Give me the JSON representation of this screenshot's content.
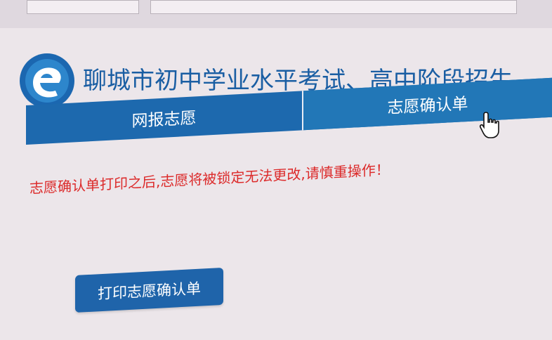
{
  "header": {
    "title": "聊城市初中学业水平考试、高中阶段招生"
  },
  "nav": {
    "tabs": [
      {
        "label": "网报志愿",
        "active": false
      },
      {
        "label": "志愿确认单",
        "active": true
      }
    ]
  },
  "notice": {
    "warning": "志愿确认单打印之后,志愿将被锁定无法更改,请慎重操作！"
  },
  "actions": {
    "print_label": "打印志愿确认单"
  },
  "colors": {
    "brand": "#1d69ae",
    "title": "#1a5ea3",
    "warning": "#dc2a2a",
    "button": "#1f64aa",
    "background": "#ece6ea"
  },
  "icons": {
    "logo": "site-logo-icon",
    "cursor": "hand-pointer-icon"
  }
}
